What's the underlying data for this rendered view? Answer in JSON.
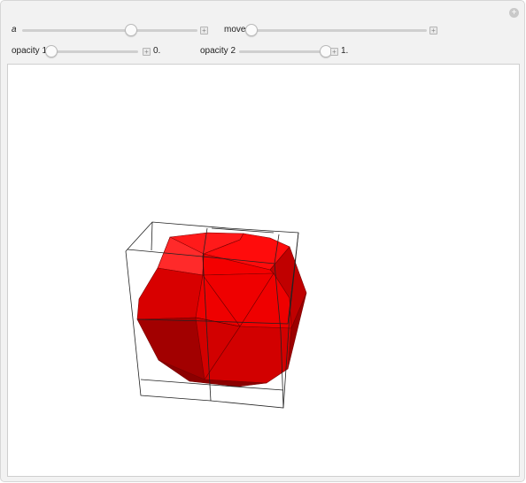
{
  "controls": {
    "a": {
      "label": "a",
      "value": 0.62
    },
    "move": {
      "label": "move",
      "value": 0.0
    },
    "opacity1": {
      "label": "opacity 1",
      "value": 0.0,
      "value_text": "0."
    },
    "opacity2": {
      "label": "opacity 2",
      "value": 1.0,
      "value_text": "1."
    }
  },
  "colors": {
    "solid_face": "#e00000",
    "panel_background": "#f2f2f2",
    "box_edges": "#222222"
  },
  "icons": {
    "corner": "plus-circle-icon",
    "slider_toggle": "plus-square-icon"
  }
}
